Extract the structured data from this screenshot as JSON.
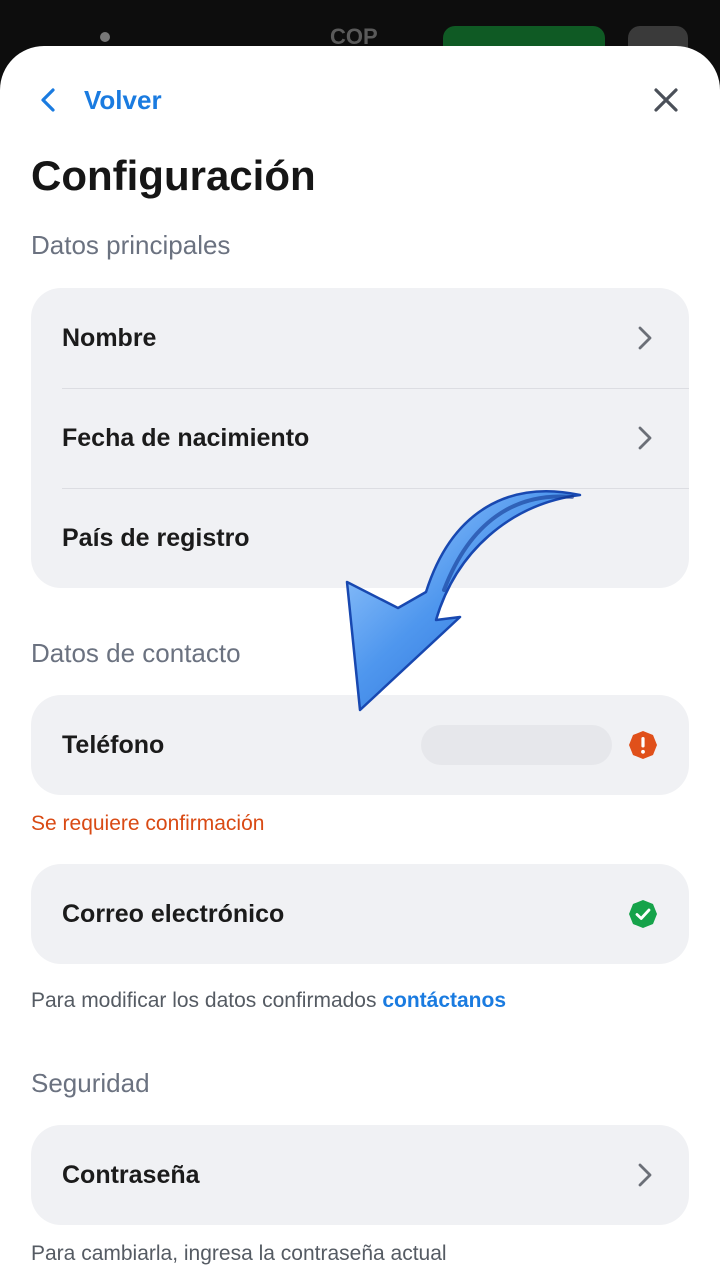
{
  "backdrop": {
    "currency": "COP"
  },
  "header": {
    "back_label": "Volver"
  },
  "page": {
    "title": "Configuración"
  },
  "main_data": {
    "label": "Datos principales",
    "items": [
      {
        "label": "Nombre"
      },
      {
        "label": "Fecha de nacimiento"
      },
      {
        "label": "País de registro"
      }
    ]
  },
  "contact": {
    "label": "Datos de contacto",
    "phone": {
      "label": "Teléfono",
      "status": "unconfirmed",
      "status_icon": "alert-icon",
      "status_color": "#e0501a",
      "error_text": "Se requiere confirmación"
    },
    "email": {
      "label": "Correo electrónico",
      "status": "confirmed",
      "status_icon": "verified-check-icon",
      "status_color": "#16a34a"
    },
    "note_text": "Para modificar los datos confirmados ",
    "note_link": "contáctanos"
  },
  "security": {
    "label": "Seguridad",
    "password": {
      "label": "Contraseña"
    },
    "note_text": "Para cambiarla, ingresa la contraseña actual"
  },
  "colors": {
    "accent": "#1a7be0",
    "error": "#d94a14",
    "success": "#16a34a",
    "card_bg": "#f0f1f4"
  }
}
